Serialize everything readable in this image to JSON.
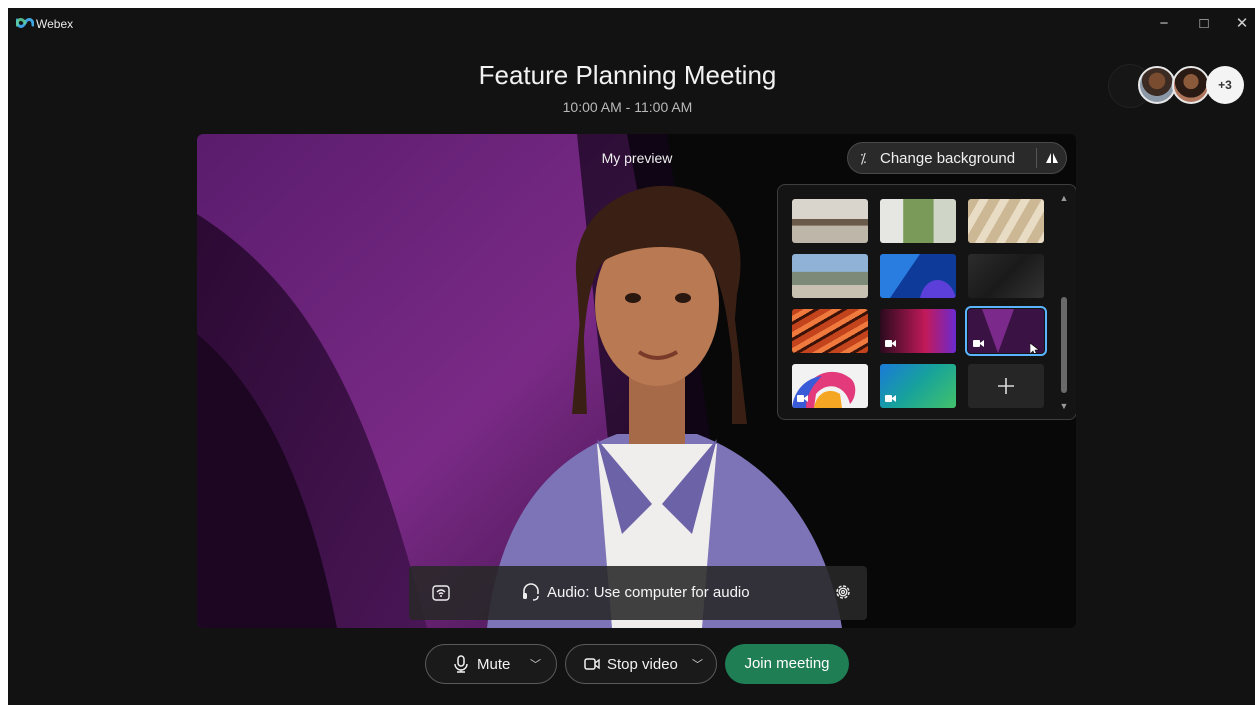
{
  "app": {
    "name": "Webex"
  },
  "window_controls": {
    "minimize": "−",
    "maximize": "□",
    "close": "✕"
  },
  "meeting": {
    "title": "Feature Planning Meeting",
    "time": "10:00 AM - 11:00 AM"
  },
  "participants": {
    "more_count": "+3"
  },
  "preview": {
    "label": "My preview",
    "change_background_label": "Change background"
  },
  "backgrounds": {
    "selected_index": 8,
    "items": [
      {
        "name": "room-interior",
        "video": false
      },
      {
        "name": "greenhouse-office",
        "video": false
      },
      {
        "name": "sunlit-wall",
        "video": false
      },
      {
        "name": "mountain-landscape",
        "video": false
      },
      {
        "name": "blue-shapes",
        "video": false
      },
      {
        "name": "dark-gray",
        "video": false
      },
      {
        "name": "orange-marble",
        "video": false
      },
      {
        "name": "pink-purple-gradient",
        "video": true
      },
      {
        "name": "purple-triangle",
        "video": true
      },
      {
        "name": "colorful-ribbon",
        "video": true
      },
      {
        "name": "teal-green-gradient",
        "video": true
      },
      {
        "name": "add",
        "video": false
      }
    ]
  },
  "audio": {
    "label": "Audio: Use computer for audio"
  },
  "controls": {
    "mute_label": "Mute",
    "video_label": "Stop video",
    "join_label": "Join meeting"
  },
  "colors": {
    "join": "#1f7e54",
    "selected_outline": "#5ab4ff"
  }
}
